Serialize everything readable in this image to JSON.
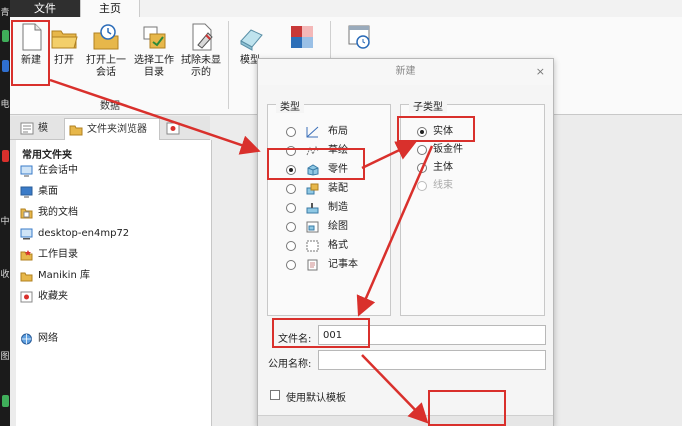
{
  "tabs": {
    "file": "文件",
    "home": "主页"
  },
  "ribbon": {
    "new_label": "新建",
    "open_label": "打开",
    "open_prev_label_1": "打开上一",
    "open_prev_label_2": "会话",
    "select_dir_label_1": "选择工作",
    "select_dir_label_2": "目录",
    "erase_label_1": "拭除未显",
    "erase_label_2": "示的",
    "model_label": "模型",
    "group_label": "数据"
  },
  "left_strip": {
    "glyph_1": "青",
    "glyph_2": "电",
    "glyph_3": "中",
    "glyph_4": "收",
    "glyph_5": "图"
  },
  "panel_tabs": {
    "model_tab": "模",
    "folder_browser_tab": "文件夹浏览器"
  },
  "folders": {
    "header": "常用文件夹",
    "items": [
      "在会话中",
      "桌面",
      "我的文档",
      "desktop-en4mp72",
      "工作目录",
      "Manikin 库",
      "收藏夹",
      "网络"
    ]
  },
  "dialog": {
    "title": "新建",
    "close": "×",
    "type_legend": "类型",
    "subtype_legend": "子类型",
    "types": [
      "布局",
      "草绘",
      "零件",
      "装配",
      "制造",
      "绘图",
      "格式",
      "记事本"
    ],
    "subtypes": [
      "实体",
      "钣金件",
      "主体",
      "线束"
    ],
    "filename_label": "文件名:",
    "filename_value": "001",
    "common_name_label": "公用名称:",
    "common_name_value": "",
    "use_template_label": "使用默认模板"
  },
  "colors": {
    "annotation_red": "#d9302c",
    "file_tab_bg": "#2f2f2f"
  }
}
